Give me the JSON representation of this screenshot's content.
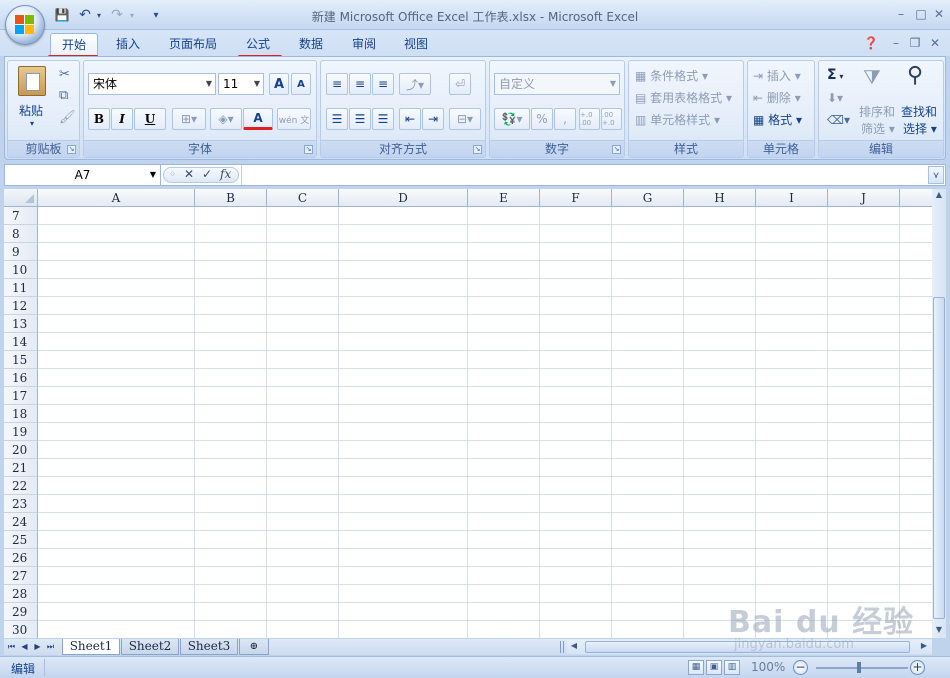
{
  "window": {
    "title": "新建 Microsoft Office Excel 工作表.xlsx - Microsoft Excel",
    "controls": {
      "minimize": "–",
      "maximize": "□",
      "close": "✕"
    }
  },
  "quick_access": {
    "save": "💾",
    "undo": "↶",
    "redo": "↷",
    "customize": "▾"
  },
  "tabs": [
    "开始",
    "插入",
    "页面布局",
    "公式",
    "数据",
    "审阅",
    "视图"
  ],
  "active_tab": "开始",
  "underlined_tabs": [
    "开始",
    "公式"
  ],
  "ribbon": {
    "clipboard": {
      "label": "剪贴板",
      "paste": "粘贴"
    },
    "font": {
      "label": "字体",
      "font_name": "宋体",
      "font_size": "11",
      "bold": "B",
      "italic": "I",
      "underline": "U",
      "grow": "A",
      "shrink": "A",
      "font_color": "A",
      "phonetic": "wén 文"
    },
    "alignment": {
      "label": "对齐方式"
    },
    "number": {
      "label": "数字",
      "format": "自定义",
      "percent": "%",
      "comma": ",",
      "inc_decimal": "+.0 .00",
      "dec_decimal": ".00 +.0"
    },
    "styles": {
      "label": "样式",
      "conditional": "条件格式",
      "table_format": "套用表格格式",
      "cell_styles": "单元格样式"
    },
    "cells": {
      "label": "单元格",
      "insert": "插入",
      "delete": "删除",
      "format": "格式"
    },
    "editing": {
      "label": "编辑",
      "sum": "Σ",
      "sort_filter_1": "排序和",
      "sort_filter_2": "筛选",
      "find_1": "查找和",
      "find_2": "选择"
    }
  },
  "formula_bar": {
    "name_box": "A7",
    "cancel": "✕",
    "enter": "✓",
    "fx": "fx",
    "value": ""
  },
  "columns": [
    "A",
    "B",
    "C",
    "D",
    "E",
    "F",
    "G",
    "H",
    "I",
    "J"
  ],
  "rows": [
    "7",
    "8",
    "9",
    "10",
    "11",
    "12",
    "13",
    "14",
    "15",
    "16",
    "17",
    "18",
    "19",
    "20",
    "21",
    "22",
    "23",
    "24",
    "25",
    "26",
    "27",
    "28",
    "29",
    "30"
  ],
  "sheets": [
    "Sheet1",
    "Sheet2",
    "Sheet3"
  ],
  "active_sheet": "Sheet1",
  "status": {
    "mode": "编辑",
    "zoom": "100%",
    "zoom_out": "−",
    "zoom_in": "+"
  },
  "watermark": {
    "brand": "Bai du 经验",
    "url": "jingyan.baidu.com"
  },
  "colors": {
    "accent": "#15428b",
    "ribbon_bg": "#dbe7f7",
    "underline": "#e02020",
    "grid_line": "#d7dfe9"
  }
}
